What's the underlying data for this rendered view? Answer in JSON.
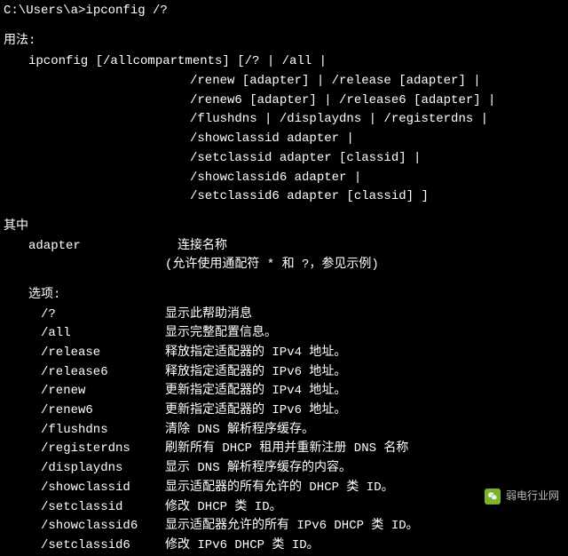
{
  "prompt": "C:\\Users\\a>ipconfig /?",
  "usage_title": "用法:",
  "usage_lines": [
    "ipconfig [/allcompartments] [/? | /all |",
    "/renew [adapter] | /release [adapter] |",
    "/renew6 [adapter] | /release6 [adapter] |",
    "/flushdns | /displaydns | /registerdns |",
    "/showclassid adapter |",
    "/setclassid adapter [classid] |",
    "/showclassid6 adapter |",
    "/setclassid6 adapter [classid] ]"
  ],
  "where_title": "其中",
  "adapter_label": "adapter",
  "adapter_desc1": "连接名称",
  "adapter_desc2": "(允许使用通配符 * 和 ?，参见示例)",
  "options_title": "选项:",
  "options": [
    {
      "flag": "/?",
      "desc": "显示此帮助消息"
    },
    {
      "flag": "/all",
      "desc": "显示完整配置信息。"
    },
    {
      "flag": "/release",
      "desc": "释放指定适配器的 IPv4 地址。"
    },
    {
      "flag": "/release6",
      "desc": "释放指定适配器的 IPv6 地址。"
    },
    {
      "flag": "/renew",
      "desc": "更新指定适配器的 IPv4 地址。"
    },
    {
      "flag": "/renew6",
      "desc": "更新指定适配器的 IPv6 地址。"
    },
    {
      "flag": "/flushdns",
      "desc": "清除 DNS 解析程序缓存。"
    },
    {
      "flag": "/registerdns",
      "desc": "刷新所有 DHCP 租用并重新注册 DNS 名称"
    },
    {
      "flag": "/displaydns",
      "desc": "显示 DNS 解析程序缓存的内容。"
    },
    {
      "flag": "/showclassid",
      "desc": "显示适配器的所有允许的 DHCP 类 ID。"
    },
    {
      "flag": "/setclassid",
      "desc": "修改 DHCP 类 ID。"
    },
    {
      "flag": "/showclassid6",
      "desc": "显示适配器允许的所有 IPv6 DHCP 类 ID。"
    },
    {
      "flag": "/setclassid6",
      "desc": "修改 IPv6 DHCP 类 ID。"
    }
  ],
  "watermark_text": "弱电行业网"
}
